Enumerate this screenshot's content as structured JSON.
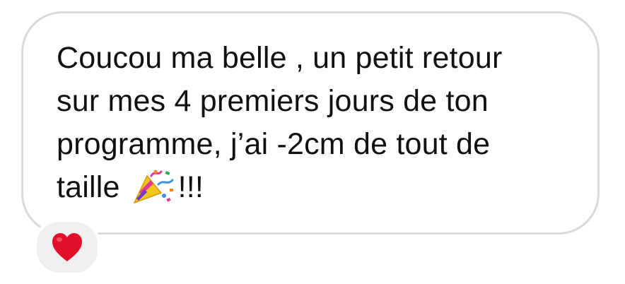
{
  "message": {
    "line1": "Coucou ma belle , un petit retour",
    "line2": "sur mes 4 premiers jours de ton",
    "line3": "programme, j’ai -2cm de tout de",
    "line4_before": "taille",
    "line4_after": "!!!",
    "emoji_icon": "party-popper-icon"
  },
  "reaction": {
    "emoji_icon": "red-heart-icon",
    "color": "#e0102a"
  },
  "colors": {
    "bubble_border": "#dadada",
    "reaction_bg": "#efefef",
    "text": "#111111"
  }
}
